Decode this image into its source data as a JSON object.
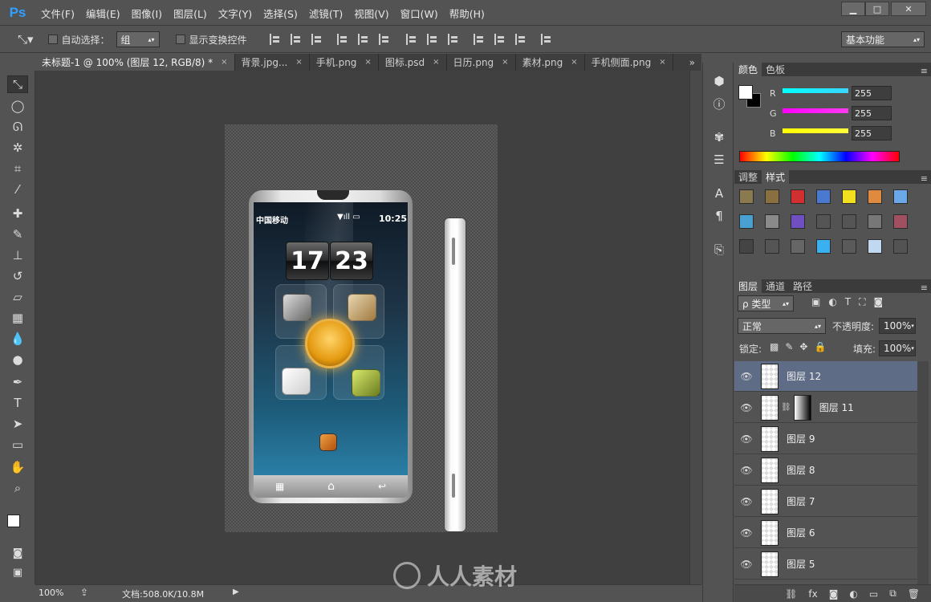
{
  "app": {
    "logo": "Ps"
  },
  "menu": [
    "文件(F)",
    "编辑(E)",
    "图像(I)",
    "图层(L)",
    "文字(Y)",
    "选择(S)",
    "滤镜(T)",
    "视图(V)",
    "窗口(W)",
    "帮助(H)"
  ],
  "window_controls": {
    "minimize": "▁",
    "maximize": "□",
    "close": "✕"
  },
  "options": {
    "auto_select_label": "自动选择：",
    "auto_select_value": "组",
    "show_transform_label": "显示变换控件",
    "workspace": "基本功能"
  },
  "tabs": [
    {
      "label": "未标题-1 @ 100% (图层 12, RGB/8) *",
      "close": "×",
      "active": true
    },
    {
      "label": "背景.jpg...",
      "close": "×"
    },
    {
      "label": "手机.png",
      "close": "×"
    },
    {
      "label": "图标.psd",
      "close": "×"
    },
    {
      "label": "日历.png",
      "close": "×"
    },
    {
      "label": "素材.png",
      "close": "×"
    },
    {
      "label": "手机侧面.png",
      "close": "×"
    }
  ],
  "tabs_overflow": "»",
  "phone": {
    "carrier": "中国移动",
    "time": "10:25",
    "hour": "17",
    "minute": "23"
  },
  "status": {
    "zoom": "100%",
    "doc": "文档:508.0K/10.8M"
  },
  "color_panel": {
    "tabs": [
      "颜色",
      "色板"
    ],
    "channels": [
      {
        "label": "R",
        "value": "255",
        "color": "#3ad6ff"
      },
      {
        "label": "G",
        "value": "255",
        "color": "#ff3af0"
      },
      {
        "label": "B",
        "value": "255",
        "color": "#ffff3a"
      }
    ]
  },
  "styles_panel": {
    "tabs": [
      "调整",
      "样式"
    ]
  },
  "layers_panel": {
    "tabs": [
      "图层",
      "通道",
      "路径"
    ],
    "filter_label": "ρ 类型",
    "blend_mode": "正常",
    "opacity_label": "不透明度:",
    "opacity_value": "100%",
    "lock_label": "锁定:",
    "fill_label": "填充:",
    "fill_value": "100%",
    "layers": [
      {
        "name": "图层 12",
        "active": true
      },
      {
        "name": "图层 11",
        "mask": true
      },
      {
        "name": "图层 9"
      },
      {
        "name": "图层 8"
      },
      {
        "name": "图层 7"
      },
      {
        "name": "图层 6"
      },
      {
        "name": "图层 5"
      }
    ]
  },
  "watermark": "人人素材"
}
